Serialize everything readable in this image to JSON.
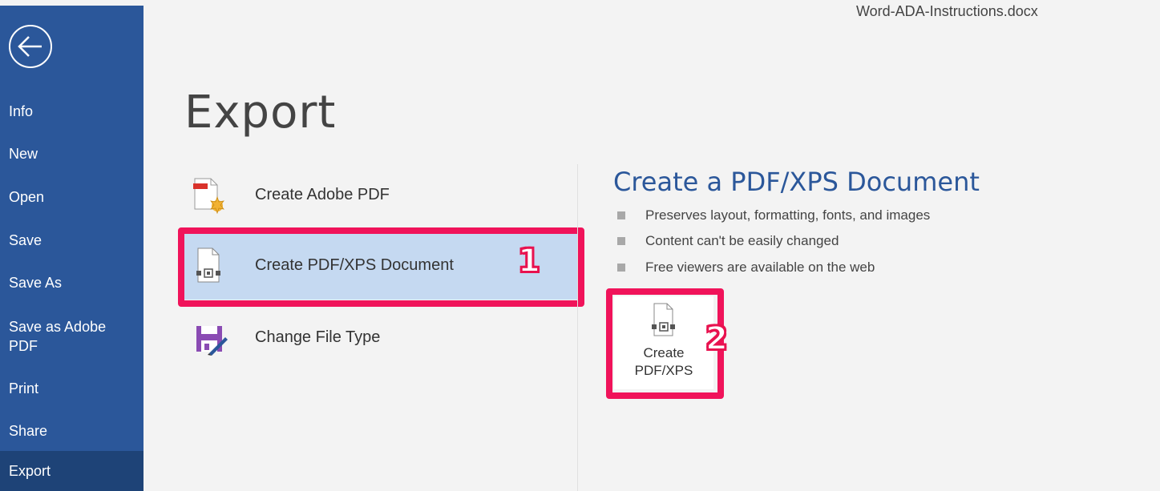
{
  "window": {
    "doc_title": "Word-ADA-Instructions.docx"
  },
  "sidebar": {
    "back_icon": "back-arrow-circle-icon",
    "items": [
      {
        "label": "Info"
      },
      {
        "label": "New"
      },
      {
        "label": "Open"
      },
      {
        "label": "Save"
      },
      {
        "label": "Save As"
      },
      {
        "label": "Save as Adobe PDF"
      },
      {
        "label": "Print"
      },
      {
        "label": "Share"
      },
      {
        "label": "Export",
        "active": true
      }
    ]
  },
  "main": {
    "title": "Export",
    "options": [
      {
        "label": "Create Adobe PDF",
        "icon": "adobe-pdf-icon"
      },
      {
        "label": "Create PDF/XPS Document",
        "icon": "pdf-xps-document-icon",
        "selected": true
      },
      {
        "label": "Change File Type",
        "icon": "change-file-type-icon"
      }
    ]
  },
  "detail": {
    "heading": "Create a PDF/XPS Document",
    "bullets": [
      "Preserves layout, formatting, fonts, and images",
      "Content can't be easily changed",
      "Free viewers are available on the web"
    ],
    "button_label_line1": "Create",
    "button_label_line2": "PDF/XPS"
  },
  "annotations": {
    "step1": "1",
    "step2": "2"
  },
  "colors": {
    "sidebar": "#2b579a",
    "sidebar_active": "#1e4377",
    "heading": "#2b579a",
    "highlight": "#f0135a",
    "selected_bg": "#c5d9f1"
  }
}
